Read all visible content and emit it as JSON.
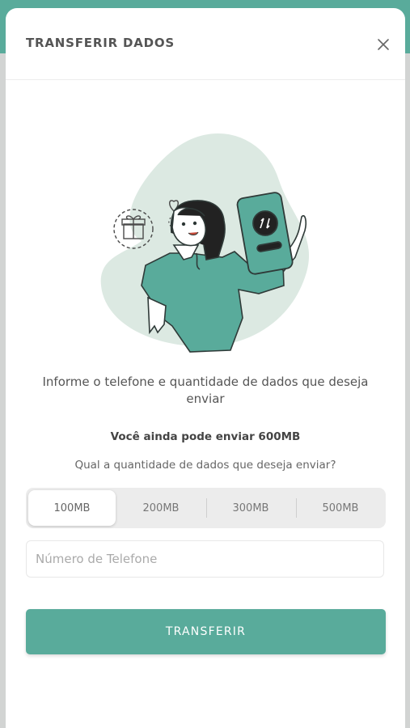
{
  "header": {
    "title": "TRANSFERIR DADOS",
    "close_icon": "close-icon"
  },
  "content": {
    "headline": "Informe o telefone e quantidade de dados que deseja enviar",
    "remaining": "Você ainda pode enviar 600MB",
    "question": "Qual a quantidade de dados que deseja enviar?"
  },
  "amount_options": {
    "items": [
      {
        "label": "100MB",
        "selected": true
      },
      {
        "label": "200MB",
        "selected": false
      },
      {
        "label": "300MB",
        "selected": false
      },
      {
        "label": "500MB",
        "selected": false
      }
    ]
  },
  "phone_field": {
    "placeholder": "Número de Telefone",
    "value": ""
  },
  "submit": {
    "label": "TRANSFERIR"
  },
  "colors": {
    "accent": "#59ab9b",
    "illustration_bg": "#dce9e2"
  },
  "icons": {
    "transfer": "swap-arrows-icon",
    "gift": "gift-icon",
    "heart": "heart-icon"
  }
}
